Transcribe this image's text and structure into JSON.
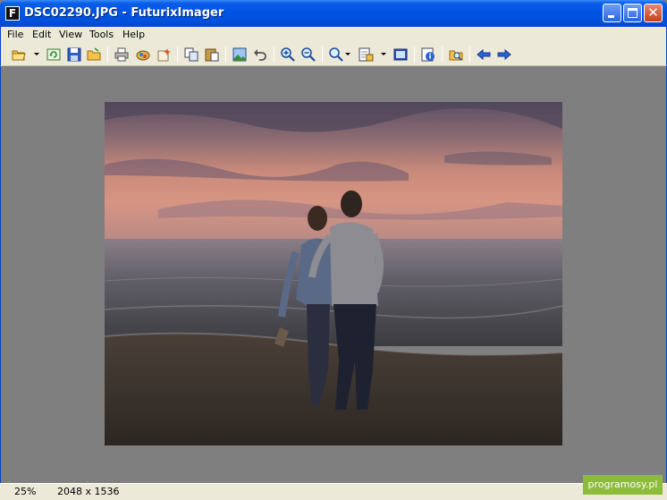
{
  "window": {
    "title": "DSC02290.JPG - FuturixImager",
    "app_icon_letter": "F"
  },
  "menu": [
    "File",
    "Edit",
    "View",
    "Tools",
    "Help"
  ],
  "toolbar": {
    "buttons": [
      "open",
      "refresh",
      "save",
      "open-folder",
      "print",
      "scan",
      "effects",
      "copy",
      "paste",
      "wallpaper",
      "undo",
      "zoom-in",
      "zoom-out",
      "zoom-menu",
      "properties",
      "fullscreen",
      "info",
      "browse",
      "previous",
      "next"
    ]
  },
  "status": {
    "zoom": "25%",
    "dimensions": "2048 x 1536"
  },
  "watermark": "programosy.pl",
  "colors": {
    "title_bar": "#0054e3",
    "canvas": "#7f7f7f",
    "chrome": "#ece9d8",
    "watermark": "#8dbb3a"
  }
}
